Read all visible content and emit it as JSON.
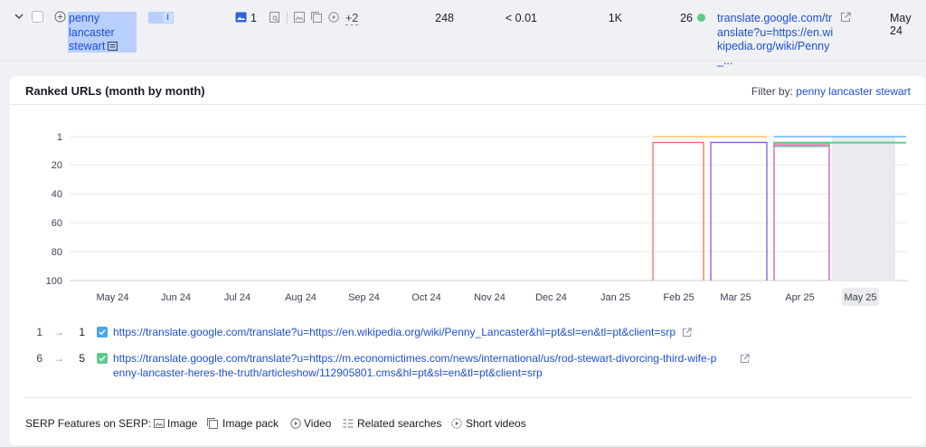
{
  "keyword_row": {
    "keyword": "penny lancaster stewart",
    "intent": "I",
    "serp_features_count": "1",
    "serp_features_more": "+2",
    "volume": "248",
    "cpc": "< 0.01",
    "results": "1K",
    "difficulty": "26",
    "difficulty_color": "#5ecb8d",
    "url": "translate.google.com/translate?u=https://en.wikipedia.org/wiki/Penny_...",
    "date": "May 24"
  },
  "card": {
    "title": "Ranked URLs (month by month)",
    "filter_label": "Filter by:",
    "filter_value": "penny lancaster stewart"
  },
  "chart_data": {
    "type": "line",
    "y_axis": {
      "ticks": [
        "1",
        "20",
        "40",
        "60",
        "80",
        "100"
      ],
      "inverted": true,
      "range": [
        1,
        100
      ]
    },
    "x_axis": {
      "categories": [
        "May 24",
        "Jun 24",
        "Jul 24",
        "Aug 24",
        "Sep 24",
        "Oct 24",
        "Nov 24",
        "Dec 24",
        "Jan 25",
        "Feb 25",
        "Mar 25",
        "Apr 25",
        "May 25"
      ],
      "highlighted": "May 25"
    },
    "grid": true,
    "series": [
      {
        "color": "#f5b640",
        "segments": [
          {
            "from": "Feb 25",
            "to": "Mar 25",
            "value": 1
          }
        ]
      },
      {
        "color": "#f06b6b",
        "segments": [
          {
            "from": "Feb 25",
            "to": "Feb 25",
            "value": 5
          },
          {
            "from": "Apr 25",
            "to": "Apr 25",
            "value": 5
          }
        ]
      },
      {
        "color": "#7b5ce0",
        "segments": [
          {
            "from": "Mar 25",
            "to": "Mar 25",
            "value": 5
          }
        ]
      },
      {
        "color": "#e06ae0",
        "segments": [
          {
            "from": "Apr 25",
            "to": "Apr 25",
            "value": 7
          }
        ]
      },
      {
        "color": "#4aa3f0",
        "segments": [
          {
            "from": "Apr 25",
            "to": "May 25",
            "value": 1
          }
        ]
      },
      {
        "color": "#5ecb8d",
        "segments": [
          {
            "from": "Apr 25",
            "to": "May 25",
            "value": 5
          }
        ]
      }
    ]
  },
  "ranked_urls": [
    {
      "from": "1",
      "to": "1",
      "checkbox_color": "#4aa3f0",
      "lines": [
        "https://translate.google.com/translate?u=https://en.wikipedia.org/wiki/Penny_Lancaster&hl=pt&sl=en&tl=pt&client=srp"
      ]
    },
    {
      "from": "6",
      "to": "5",
      "checkbox_color": "#5ecb8d",
      "lines": [
        "https://translate.google.com/translate?u=https://m.economictimes.com/news/international/us/rod-stewart-divorcing-third-wife-p",
        "enny-lancaster-heres-the-truth/articleshow/112905801.cms&hl=pt&sl=en&tl=pt&client=srp"
      ]
    }
  ],
  "serp_features": {
    "label": "SERP Features on SERP:",
    "items": [
      {
        "label": "Image",
        "icon": "image-icon"
      },
      {
        "label": "Image pack",
        "icon": "image-pack-icon"
      },
      {
        "label": "Video",
        "icon": "video-icon"
      },
      {
        "label": "Related searches",
        "icon": "related-searches-icon"
      },
      {
        "label": "Short videos",
        "icon": "short-videos-icon"
      }
    ]
  }
}
